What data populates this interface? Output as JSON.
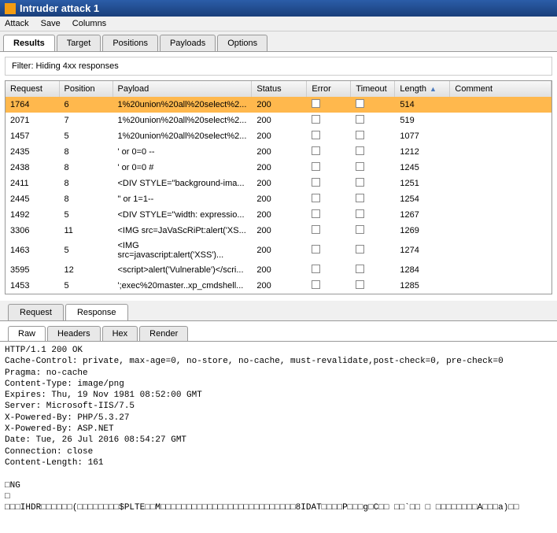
{
  "title": "Intruder attack 1",
  "menus": [
    "Attack",
    "Save",
    "Columns"
  ],
  "mainTabs": [
    "Results",
    "Target",
    "Positions",
    "Payloads",
    "Options"
  ],
  "mainTabActive": 0,
  "filterText": "Filter: Hiding 4xx responses",
  "columns": [
    "Request",
    "Position",
    "Payload",
    "Status",
    "Error",
    "Timeout",
    "Length",
    "Comment"
  ],
  "sortedCol": 6,
  "rows": [
    {
      "request": "1764",
      "position": "6",
      "payload": "1%20union%20all%20select%2...",
      "status": "200",
      "length": "514",
      "selected": true
    },
    {
      "request": "2071",
      "position": "7",
      "payload": "1%20union%20all%20select%2...",
      "status": "200",
      "length": "519"
    },
    {
      "request": "1457",
      "position": "5",
      "payload": "1%20union%20all%20select%2...",
      "status": "200",
      "length": "1077"
    },
    {
      "request": "2435",
      "position": "8",
      "payload": "' or 0=0 --",
      "status": "200",
      "length": "1212"
    },
    {
      "request": "2438",
      "position": "8",
      "payload": "' or 0=0 #",
      "status": "200",
      "length": "1245"
    },
    {
      "request": "2411",
      "position": "8",
      "payload": "<DIV STYLE=\"background-ima...",
      "status": "200",
      "length": "1251"
    },
    {
      "request": "2445",
      "position": "8",
      "payload": "\" or 1=1--",
      "status": "200",
      "length": "1254"
    },
    {
      "request": "1492",
      "position": "5",
      "payload": "<DIV STYLE=\"width: expressio...",
      "status": "200",
      "length": "1267"
    },
    {
      "request": "3306",
      "position": "11",
      "payload": "<IMG src=JaVaScRiPt:alert('XS...",
      "status": "200",
      "length": "1269"
    },
    {
      "request": "1463",
      "position": "5",
      "payload": "<IMG src=javascript:alert('XSS')...",
      "status": "200",
      "length": "1274"
    },
    {
      "request": "3595",
      "position": "12",
      "payload": "<script>alert('Vulnerable')</scri...",
      "status": "200",
      "length": "1284"
    },
    {
      "request": "1453",
      "position": "5",
      "payload": "';exec%20master..xp_cmdshell...",
      "status": "200",
      "length": "1285"
    }
  ],
  "subTabs": [
    "Request",
    "Response"
  ],
  "subTabActive": 1,
  "innerTabs": [
    "Raw",
    "Headers",
    "Hex",
    "Render"
  ],
  "innerTabActive": 0,
  "rawText": "HTTP/1.1 200 OK\nCache-Control: private, max-age=0, no-store, no-cache, must-revalidate,post-check=0, pre-check=0\nPragma: no-cache\nContent-Type: image/png\nExpires: Thu, 19 Nov 1981 08:52:00 GMT\nServer: Microsoft-IIS/7.5\nX-Powered-By: PHP/5.3.27\nX-Powered-By: ASP.NET\nDate: Tue, 26 Jul 2016 08:54:27 GMT\nConnection: close\nContent-Length: 161\n\n□NG\n□\n□□□IHDR□□□□□□(□□□□□□□□$PLTE□□M□□□□□□□□□□□□□□□□□□□□□□□□□□8IDAT□□□□P□□□g□C□□ □□`□□ □ □□□□□□□□A□□□a)□□"
}
